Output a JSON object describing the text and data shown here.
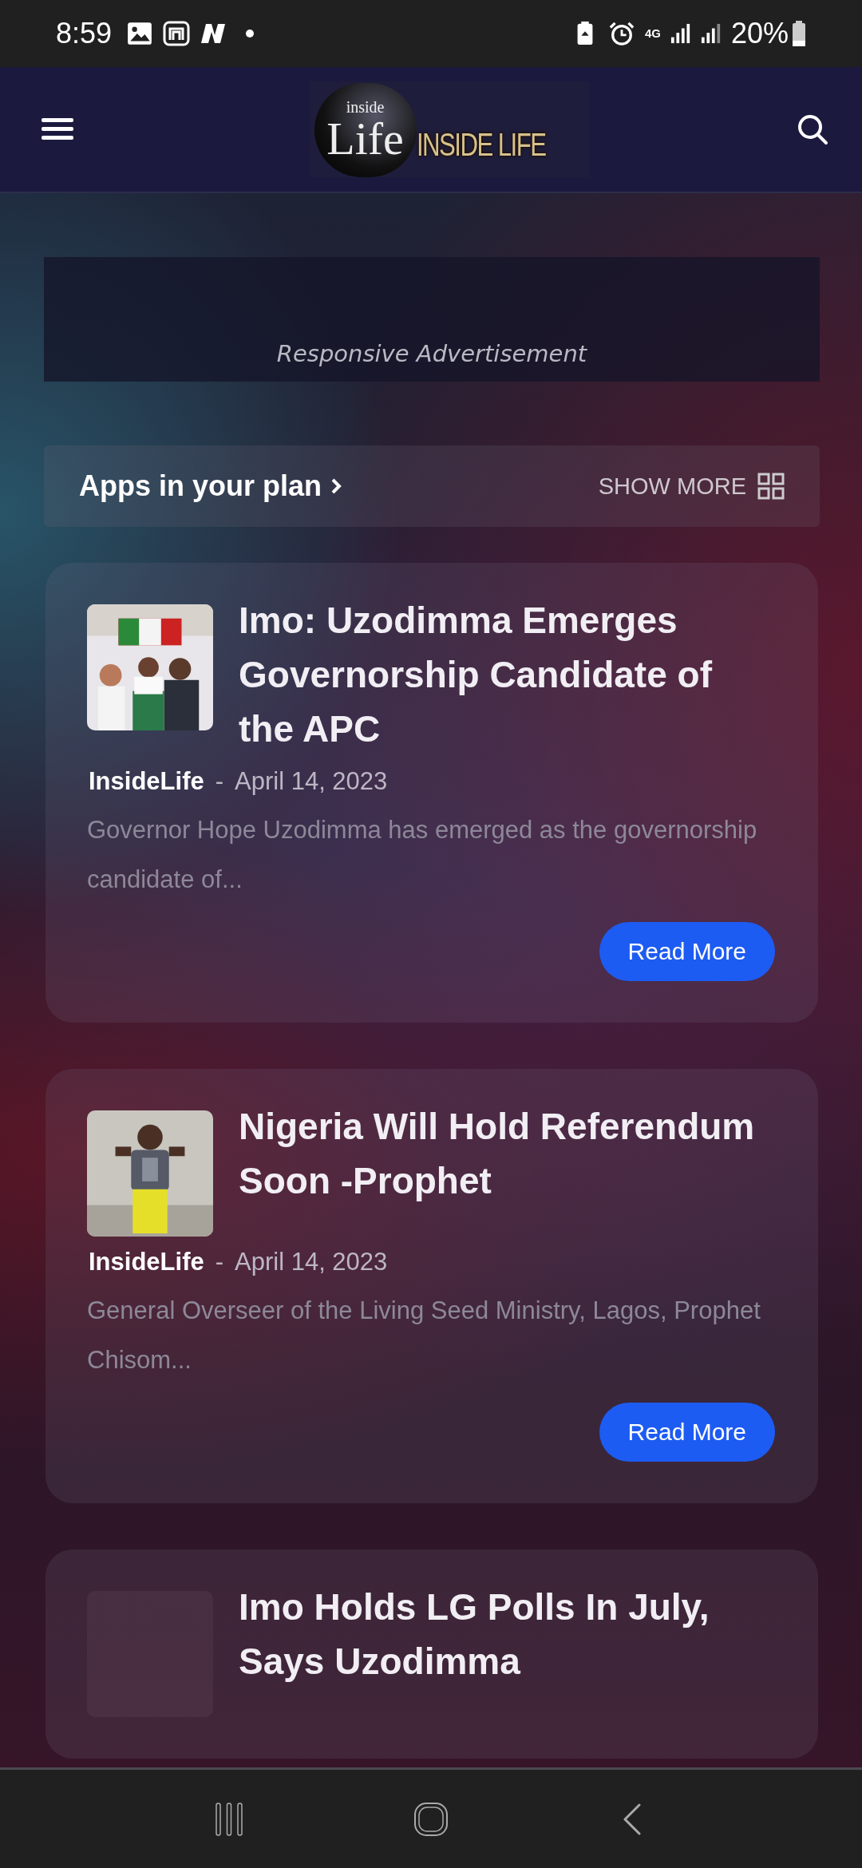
{
  "status_bar": {
    "time": "8:59",
    "network": "4G",
    "battery": "20%"
  },
  "header": {
    "logo": {
      "small": "inside",
      "big": "Life",
      "wordmark": "INSIDE LIFE"
    }
  },
  "advertisement": {
    "label": "Responsive Advertisement"
  },
  "apps_bar": {
    "title": "Apps in your plan",
    "action": "SHOW MORE"
  },
  "posts": [
    {
      "kind": "picture",
      "title": "Imo: Uzodimma Emerges Governorship Candidate of the APC",
      "author": "InsideLife",
      "separator": "-",
      "date": "April 14, 2023",
      "excerpt": "Governor Hope Uzodimma has emerged as the governorship candidate of...",
      "button": "Read More"
    },
    {
      "kind": "picture",
      "title": "Nigeria Will Hold Referendum Soon -Prophet",
      "author": "InsideLife",
      "separator": "-",
      "date": "April 14, 2023",
      "excerpt": "General Overseer of the Living Seed Ministry, Lagos, Prophet Chisom...",
      "button": "Read More"
    },
    {
      "kind": "placeholder",
      "title": "Imo Holds LG Polls In July, Says Uzodimma"
    }
  ]
}
